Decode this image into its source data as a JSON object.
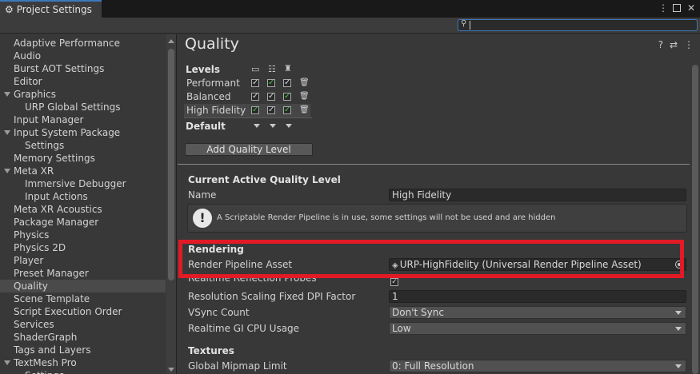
{
  "window": {
    "tab_title": "Project Settings",
    "tab_icon": "gear-icon"
  },
  "search": {
    "placeholder": "",
    "value": ""
  },
  "sidebar": {
    "items": [
      {
        "label": "Adaptive Performance",
        "indent": 0
      },
      {
        "label": "Audio",
        "indent": 0
      },
      {
        "label": "Burst AOT Settings",
        "indent": 0
      },
      {
        "label": "Editor",
        "indent": 0
      },
      {
        "label": "Graphics",
        "indent": 0,
        "expanded": true
      },
      {
        "label": "URP Global Settings",
        "indent": 1
      },
      {
        "label": "Input Manager",
        "indent": 0
      },
      {
        "label": "Input System Package",
        "indent": 0,
        "expanded": true
      },
      {
        "label": "Settings",
        "indent": 1
      },
      {
        "label": "Memory Settings",
        "indent": 0
      },
      {
        "label": "Meta XR",
        "indent": 0,
        "expanded": true
      },
      {
        "label": "Immersive Debugger",
        "indent": 1
      },
      {
        "label": "Input Actions",
        "indent": 1
      },
      {
        "label": "Meta XR Acoustics",
        "indent": 0
      },
      {
        "label": "Package Manager",
        "indent": 0
      },
      {
        "label": "Physics",
        "indent": 0
      },
      {
        "label": "Physics 2D",
        "indent": 0
      },
      {
        "label": "Player",
        "indent": 0
      },
      {
        "label": "Preset Manager",
        "indent": 0
      },
      {
        "label": "Quality",
        "indent": 0,
        "selected": true
      },
      {
        "label": "Scene Template",
        "indent": 0
      },
      {
        "label": "Script Execution Order",
        "indent": 0
      },
      {
        "label": "Services",
        "indent": 0
      },
      {
        "label": "ShaderGraph",
        "indent": 0
      },
      {
        "label": "Tags and Layers",
        "indent": 0
      },
      {
        "label": "TextMesh Pro",
        "indent": 0,
        "expanded": true
      },
      {
        "label": "Settings",
        "indent": 1
      }
    ]
  },
  "main": {
    "title": "Quality",
    "levels": {
      "heading": "Levels",
      "platform_icons": [
        "monitor-icon",
        "server-icon",
        "android-icon"
      ],
      "rows": [
        {
          "name": "Performant",
          "checks": [
            true,
            true,
            true
          ],
          "green": [
            false,
            true,
            false
          ]
        },
        {
          "name": "Balanced",
          "checks": [
            true,
            true,
            true
          ],
          "green": [
            false,
            false,
            true
          ]
        },
        {
          "name": "High Fidelity",
          "checks": [
            true,
            true,
            true
          ],
          "green": [
            true,
            false,
            true
          ],
          "highlighted": true
        }
      ],
      "default_label": "Default",
      "add_button": "Add Quality Level"
    },
    "current": {
      "heading": "Current Active Quality Level",
      "name_label": "Name",
      "name_value": "High Fidelity",
      "help_text": "A Scriptable Render Pipeline is in use, some settings will not be used and are hidden"
    },
    "rendering": {
      "heading": "Rendering",
      "pipeline_label": "Render Pipeline Asset",
      "pipeline_value": "URP-HighFidelity (Universal Render Pipeline Asset)",
      "reflection_label": "Realtime Reflection Probes",
      "reflection_checked": true,
      "dpi_label": "Resolution Scaling Fixed DPI Factor",
      "dpi_value": "1",
      "vsync_label": "VSync Count",
      "vsync_value": "Don't Sync",
      "gi_label": "Realtime GI CPU Usage",
      "gi_value": "Low"
    },
    "textures": {
      "heading": "Textures",
      "mip_label": "Global Mipmap Limit",
      "mip_value": "0: Full Resolution"
    }
  },
  "colors": {
    "accent": "#3a79bb",
    "highlight_border": "#e21a26",
    "check_green": "#44c040"
  }
}
